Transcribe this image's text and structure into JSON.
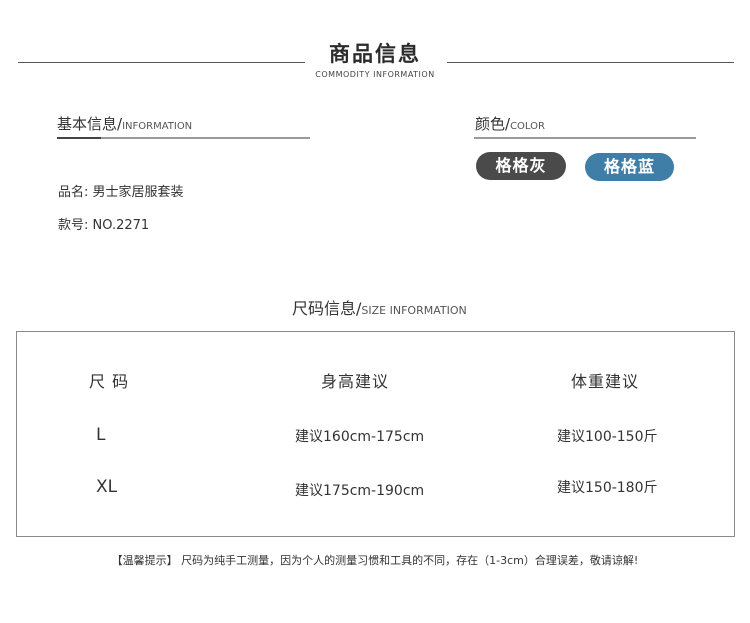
{
  "header": {
    "title": "商品信息",
    "subtitle": "COMMODITY INFORMATION"
  },
  "basic_info": {
    "heading_cn": "基本信息/",
    "heading_en": "INFORMATION",
    "rows": [
      {
        "label": "品名:",
        "value": "男士家居服套装"
      },
      {
        "label": "款号:",
        "value": "NO.2271"
      }
    ]
  },
  "color": {
    "heading_cn": "颜色/",
    "heading_en": "COLOR",
    "options": [
      {
        "label": "格格灰",
        "color": "#4a4a4a"
      },
      {
        "label": "格格蓝",
        "color": "#3f7ea6"
      }
    ]
  },
  "size_info": {
    "heading_cn": "尺码信息/",
    "heading_en": "SIZE INFORMATION",
    "columns": [
      "尺 码",
      "身高建议",
      "体重建议"
    ],
    "rows": [
      {
        "size": "L",
        "height": "建议160cm-175cm",
        "weight": "建议100-150斤"
      },
      {
        "size": "XL",
        "height": "建议175cm-190cm",
        "weight": "建议150-180斤"
      }
    ]
  },
  "note": "【温馨提示】 尺码为纯手工测量，因为个人的测量习惯和工具的不同，存在（1-3cm）合理误差，敬请谅解!"
}
